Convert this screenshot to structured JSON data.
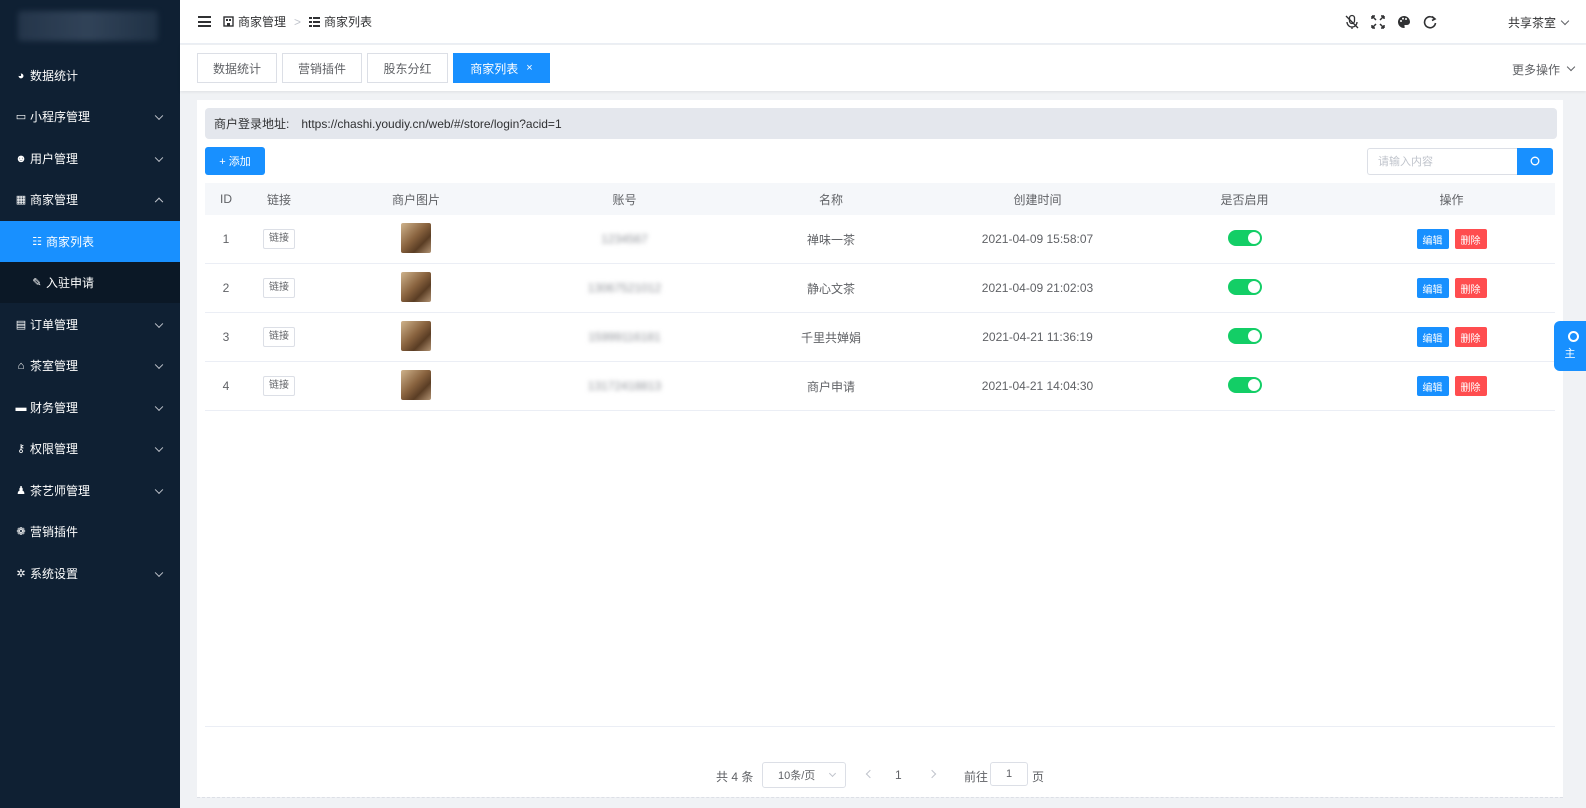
{
  "sidebar": {
    "items": [
      {
        "label": "数据统计",
        "icon": "dashboard-icon"
      },
      {
        "label": "小程序管理",
        "icon": "monitor-icon",
        "expandable": true
      },
      {
        "label": "用户管理",
        "icon": "users-icon",
        "expandable": true
      },
      {
        "label": "商家管理",
        "icon": "building-icon",
        "expandable": true,
        "expanded": true
      },
      {
        "label": "商家列表",
        "icon": "list-icon",
        "sub": true,
        "active": true
      },
      {
        "label": "入驻申请",
        "icon": "edit-icon",
        "sub": true
      },
      {
        "label": "订单管理",
        "icon": "clipboard-icon",
        "expandable": true
      },
      {
        "label": "茶室管理",
        "icon": "home-icon",
        "expandable": true
      },
      {
        "label": "财务管理",
        "icon": "wallet-icon",
        "expandable": true
      },
      {
        "label": "权限管理",
        "icon": "key-icon",
        "expandable": true
      },
      {
        "label": "茶艺师管理",
        "icon": "user-tie-icon",
        "expandable": true
      },
      {
        "label": "营销插件",
        "icon": "plugin-icon"
      },
      {
        "label": "系统设置",
        "icon": "gear-icon",
        "expandable": true
      }
    ]
  },
  "header": {
    "breadcrumb": [
      "商家管理",
      "商家列表"
    ],
    "breadcrumb_sep": ">",
    "user_name": "共享茶室"
  },
  "tabs": {
    "items": [
      "数据统计",
      "营销插件",
      "股东分红",
      "商家列表"
    ],
    "close_glyph": "×",
    "more_ops": "更多操作"
  },
  "content": {
    "login_url_label": "商户登录地址:",
    "login_url": "https://chashi.youdiy.cn/web/#/store/login?acid=1",
    "add_label": "+ 添加",
    "search_placeholder": "请输入内容"
  },
  "table": {
    "columns": [
      "ID",
      "链接",
      "商户图片",
      "账号",
      "名称",
      "创建时间",
      "是否启用",
      "操作"
    ],
    "link_label": "链接",
    "edit_label": "编辑",
    "delete_label": "删除",
    "rows": [
      {
        "id": "1",
        "account": "1234567",
        "name": "禅味一茶",
        "created": "2021-04-09 15:58:07",
        "enabled": true
      },
      {
        "id": "2",
        "account": "13067521012",
        "name": "静心文茶",
        "created": "2021-04-09 21:02:03",
        "enabled": true
      },
      {
        "id": "3",
        "account": "15999116181",
        "name": "千里共婵娟",
        "created": "2021-04-21 11:36:19",
        "enabled": true
      },
      {
        "id": "4",
        "account": "13172418813",
        "name": "商户申请",
        "created": "2021-04-21 14:04:30",
        "enabled": true
      }
    ]
  },
  "pagination": {
    "total": "共 4 条",
    "page_size": "10条/页",
    "current": "1",
    "goto_label": "前往",
    "goto_value": "1",
    "page_suffix": "页"
  },
  "side_widget": {
    "label": "主"
  },
  "colors": {
    "sidebar_bg": "#0f2033",
    "primary": "#1890ff",
    "danger": "#ff4d4f",
    "switch_on": "#13ce66"
  }
}
